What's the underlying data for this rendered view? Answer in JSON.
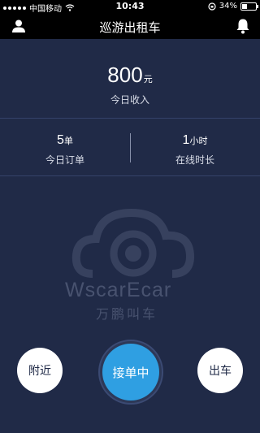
{
  "status_bar": {
    "carrier": "中国移动",
    "time": "10:43",
    "battery": "34%",
    "battery_level": 0.34,
    "icons": [
      "signal-dots-icon",
      "wifi-icon",
      "rotation-lock-icon",
      "battery-icon"
    ]
  },
  "header": {
    "title": "巡游出租车",
    "left_icon": "user-icon",
    "right_icon": "bell-icon"
  },
  "income": {
    "amount": "800",
    "unit": "元",
    "label": "今日收入"
  },
  "stats": {
    "orders": {
      "value": "5",
      "unit": "单",
      "label": "今日订单"
    },
    "online": {
      "value": "1",
      "unit": "小时",
      "label": "在线时长"
    }
  },
  "watermark": {
    "brand_en": "WscarEcar",
    "brand_cn": "万鹏叫车"
  },
  "actions": {
    "nearby": "附近",
    "accepting": "接单中",
    "depart": "出车"
  },
  "colors": {
    "background": "#202a47",
    "bar": "#000000",
    "accent": "#2f9fe2",
    "divider": "#35426a"
  }
}
